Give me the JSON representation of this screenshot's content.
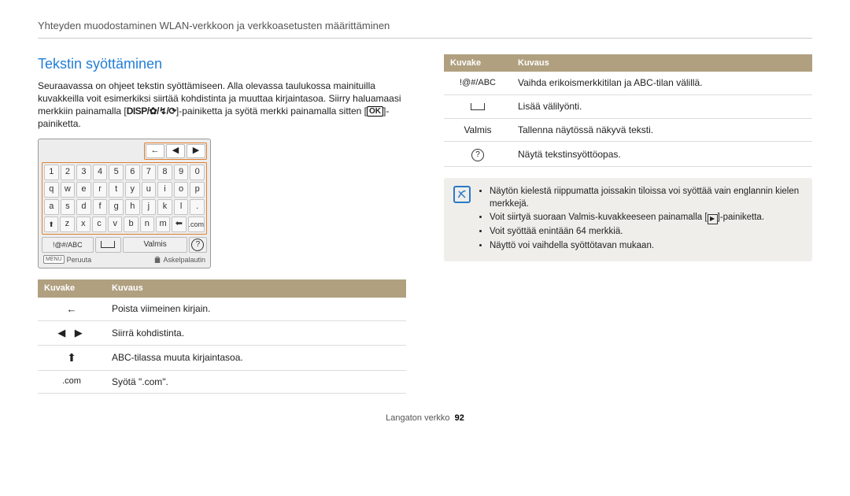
{
  "header": "Yhteyden muodostaminen WLAN-verkkoon ja verkkoasetusten määrittäminen",
  "section_title": "Tekstin syöttäminen",
  "intro": {
    "part1": "Seuraavassa on ohjeet tekstin syöttämiseen. Alla olevassa taulukossa mainituilla kuvakkeilla voit esimerkiksi siirtää kohdistinta ja muuttaa kirjaintasoa. Siirry haluamaasi merkkiin painamalla [",
    "disp": "DISP/",
    "part2": "]-painiketta ja syötä merkki painamalla sitten [",
    "ok": "OK",
    "part3": "]-painiketta."
  },
  "kbd": {
    "nav": [
      "←",
      "◀",
      "▶"
    ],
    "rows": [
      [
        "1",
        "2",
        "3",
        "4",
        "5",
        "6",
        "7",
        "8",
        "9",
        "0"
      ],
      [
        "q",
        "w",
        "e",
        "r",
        "t",
        "y",
        "u",
        "i",
        "o",
        "p"
      ],
      [
        "a",
        "s",
        "d",
        "f",
        "g",
        "h",
        "j",
        "k",
        "l",
        "."
      ],
      [
        "⬆",
        "z",
        "x",
        "c",
        "v",
        "b",
        "n",
        "m",
        "⬅",
        ".com"
      ]
    ],
    "func": {
      "abc": "!@#/ABC",
      "done": "Valmis"
    },
    "bottom_left_pill": "MENU",
    "bottom_left": "Peruuta",
    "bottom_right": "Askelpalautin"
  },
  "table_left": {
    "h1": "Kuvake",
    "h2": "Kuvaus",
    "rows": [
      {
        "icon": "←",
        "desc": "Poista viimeinen kirjain."
      },
      {
        "icon": "◀  ▶",
        "desc": "Siirrä kohdistinta."
      },
      {
        "icon": "⬆",
        "desc": "ABC-tilassa muuta kirjaintasoa."
      },
      {
        "icon": ".com",
        "desc": "Syötä \".com\"."
      }
    ]
  },
  "table_right": {
    "h1": "Kuvake",
    "h2": "Kuvaus",
    "rows": [
      {
        "icon": "!@#/ABC",
        "desc": "Vaihda erikoismerkkitilan ja ABC-tilan välillä."
      },
      {
        "icon": "space",
        "desc": "Lisää välilyönti."
      },
      {
        "icon": "Valmis",
        "desc": "Tallenna näytössä näkyvä teksti."
      },
      {
        "icon": "help",
        "desc": "Näytä tekstinsyöttöopas."
      }
    ]
  },
  "note": {
    "items": [
      {
        "text": "Näytön kielestä riippumatta joissakin tiloissa voi syöttää vain englannin kielen merkkejä."
      },
      {
        "part1": "Voit siirtyä suoraan ",
        "valmis": "Valmis",
        "part2": "-kuvakkeeseen painamalla [",
        "part3": "]-painiketta."
      },
      {
        "text": "Voit syöttää enintään 64 merkkiä."
      },
      {
        "text": "Näyttö voi vaihdella syöttötavan mukaan."
      }
    ]
  },
  "footer": {
    "label": "Langaton verkko",
    "page": "92"
  }
}
